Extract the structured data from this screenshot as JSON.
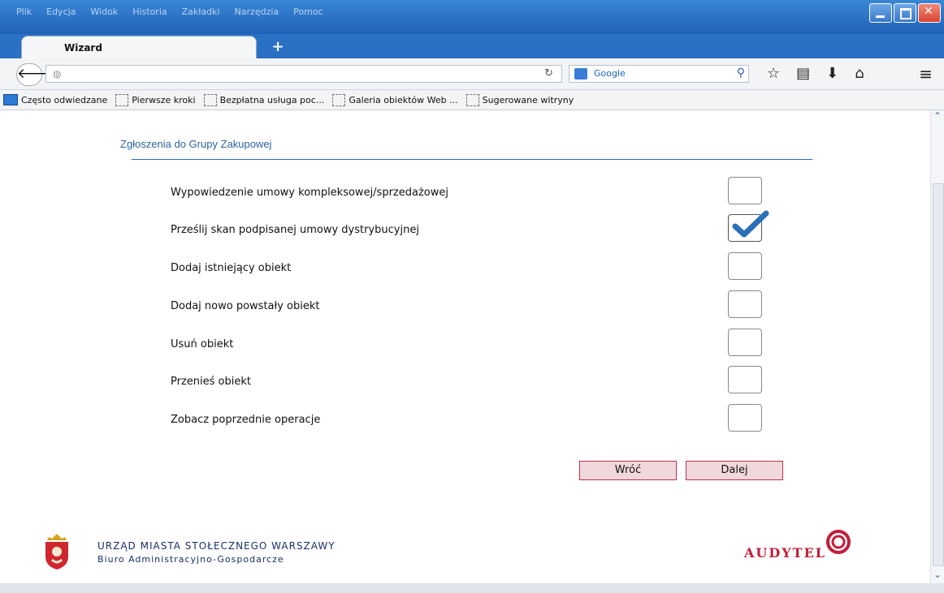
{
  "window": {
    "menu": [
      "Plik",
      "Edycja",
      "Widok",
      "Historia",
      "Zakładki",
      "Narzędzia",
      "Pomoc"
    ],
    "tab_title": "Wizard",
    "new_tab": "+",
    "search_engine": "Google",
    "bookmarks": [
      "Często odwiedzane",
      "Pierwsze kroki",
      "Bezpłatna usługa poc...",
      "Galeria obiektów Web ...",
      "Sugerowane witryny"
    ]
  },
  "page": {
    "section_title": "Zgłoszenia do Grupy Zakupowej",
    "options": [
      {
        "label": "Wypowiedzenie umowy kompleksowej/sprzedażowej",
        "checked": false
      },
      {
        "label": "Prześlij skan podpisanej umowy dystrybucyjnej",
        "checked": true
      },
      {
        "label": "Dodaj istniejący obiekt",
        "checked": false
      },
      {
        "label": "Dodaj nowo powstały obiekt",
        "checked": false
      },
      {
        "label": "Usuń obiekt",
        "checked": false
      },
      {
        "label": "Przenieś obiekt",
        "checked": false
      },
      {
        "label": "Zobacz poprzednie operacje",
        "checked": false
      }
    ],
    "buttons": {
      "back": "Wróć",
      "next": "Dalej"
    },
    "footer": {
      "org_line1": "URZĄD MIASTA STOŁECZNEGO WARSZAWY",
      "org_line2": "Biuro Administracyjno-Gospodarcze",
      "brand": "AUDYTEL"
    }
  },
  "colors": {
    "accent": "#2f6bb0",
    "button_border": "#c0304a",
    "brand": "#c21d3a",
    "check": "#2a6fb7"
  }
}
